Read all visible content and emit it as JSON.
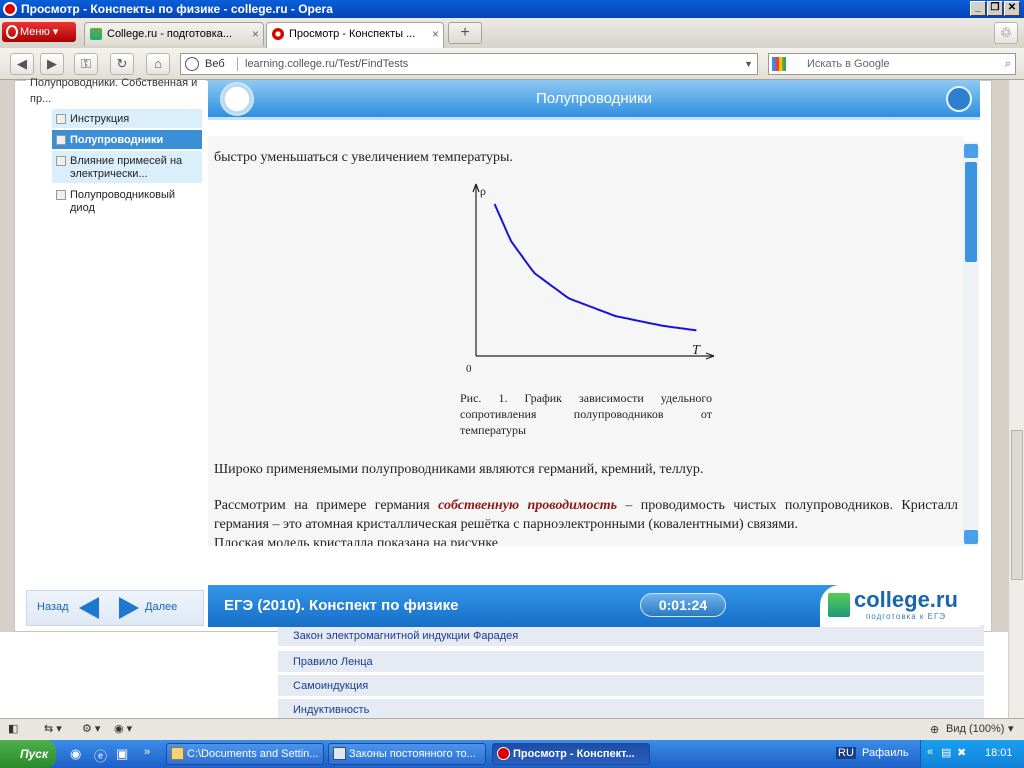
{
  "window": {
    "title": "Просмотр - Конспекты по физике - college.ru - Opera"
  },
  "tabs": {
    "menu_label": "Меню",
    "items": [
      {
        "label": "College.ru - подготовка..."
      },
      {
        "label": "Просмотр - Конспекты ..."
      }
    ],
    "new_tab": "+"
  },
  "address": {
    "web_label": "Веб",
    "url": "learning.college.ru/Test/FindTests",
    "search_placeholder": "Искать в Google"
  },
  "nav": {
    "top_label": "Полупроводники. Собственная и пр...",
    "items": [
      {
        "label": "Инструкция"
      },
      {
        "label": "Полупроводники"
      },
      {
        "label": "Влияние примесей на электрически..."
      },
      {
        "label": "Полупроводниковый диод"
      }
    ],
    "back_label": "Назад",
    "next_label": "Далее"
  },
  "lesson": {
    "title": "Полупроводники",
    "text_top": "быстро уменьшаться с увеличением температуры.",
    "axis_y": "ρ",
    "axis_x": "T",
    "origin": "0",
    "caption": "Рис. 1. График зависимости удельного сопротивления полупроводников от температуры",
    "para1": "Широко применяемыми полупроводниками являются германий, кремний, теллур.",
    "para2_start": "Рассмотрим на примере германия",
    "para2_term": "собственную проводимость",
    "para2_rest": "– проводимость чистых полупроводников. Кристалл германия – это атомная кристаллическая решётка с парноэлектронными (ковалентными) связями.",
    "para3": "Плоская модель кристалла показана на рисунке",
    "footer_title": "ЕГЭ (2010). Конспект по физике",
    "timer": "0:01:24",
    "logo_text": "college.ru",
    "logo_sub": "подготовка к ЕГЭ",
    "curve_color": "#1515d9"
  },
  "chart_data": {
    "type": "line",
    "title": "",
    "xlabel": "T",
    "ylabel": "ρ",
    "series": [
      {
        "x": [
          0.08,
          0.15,
          0.25,
          0.4,
          0.6,
          0.8,
          0.95
        ],
        "y": [
          0.95,
          0.72,
          0.52,
          0.36,
          0.25,
          0.19,
          0.16
        ]
      }
    ],
    "xlim": [
      0,
      1
    ],
    "ylim": [
      0,
      1
    ]
  },
  "background_links": [
    {
      "label": "Закон электромагнитной индукции Фарадея"
    },
    {
      "label": "Правило Ленца"
    },
    {
      "label": "Самоиндукция"
    },
    {
      "label": "Индуктивность"
    }
  ],
  "statusbar": {
    "zoom": "Вид (100%)"
  },
  "taskbar": {
    "start": "Пуск",
    "tasks": [
      {
        "label": "C:\\Documents and Settin..."
      },
      {
        "label": "Законы постоянного то..."
      },
      {
        "label": "Просмотр - Конспект..."
      }
    ],
    "lang": "RU",
    "user": "Рафаиль",
    "time": "18:01"
  }
}
